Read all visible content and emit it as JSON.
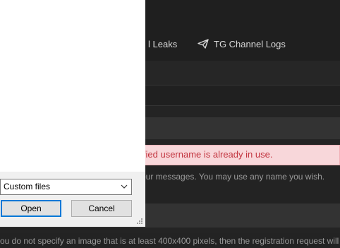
{
  "nav": {
    "leaks_label": "l Leaks",
    "tg_logs_label": "TG Channel Logs",
    "tg_logs_icon": "paper-plane-icon"
  },
  "form": {
    "error_text": "ified username is already in use.",
    "help_text": "our messages. You may use any name you wish.",
    "image_note": "ou do not specify an image that is at least 400x400 pixels, then the registration request will"
  },
  "dialog": {
    "file_type_selected": "Custom files",
    "open_label": "Open",
    "cancel_label": "Cancel"
  },
  "colors": {
    "page_bg": "#232323",
    "error_bg": "#f8d7da",
    "error_text": "#c2343f",
    "focus_border": "#0078d7"
  }
}
